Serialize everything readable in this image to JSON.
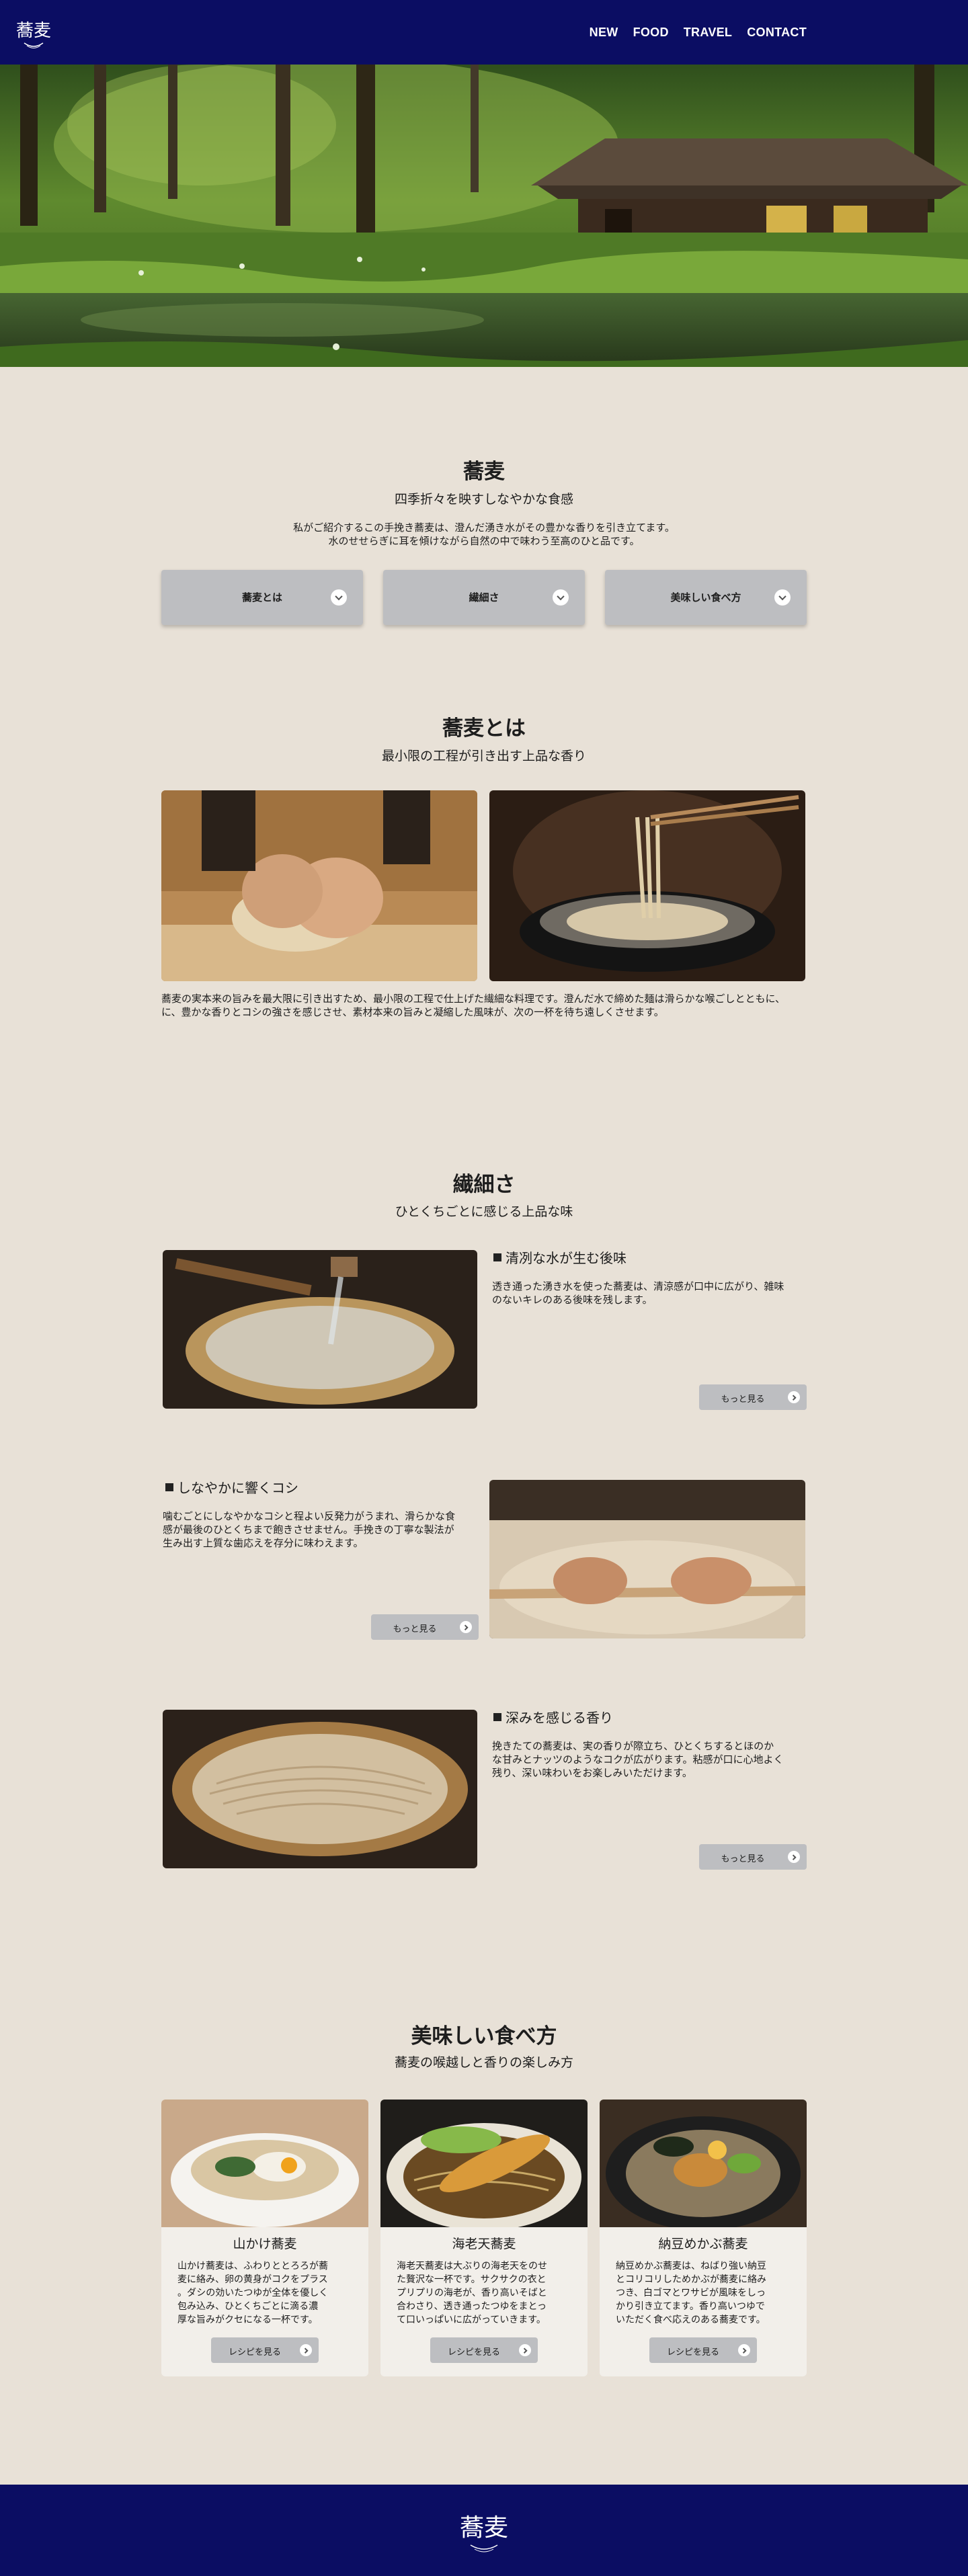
{
  "header": {
    "logo_text": "蕎麦",
    "nav": [
      "NEW",
      "FOOD",
      "TRAVEL",
      "CONTACT"
    ]
  },
  "soba": {
    "title": "蕎麦",
    "subtitle": "四季折々を映すしなやかな食感",
    "intro_line1": "私がご紹介するこの手挽き蕎麦は、澄んだ湧き水がその豊かな香りを引き立てます。",
    "intro_line2": "水のせせらぎに耳を傾けながら自然の中で味わう至高のひと品です。",
    "accordion": [
      "蕎麦とは",
      "繊細さ",
      "美味しい食べ方"
    ]
  },
  "about": {
    "title": "蕎麦とは",
    "subtitle": "最小限の工程が引き出す上品な香り",
    "text_line1": "蕎麦の実本来の旨みを最大限に引き出すため、最小限の工程で仕上げた繊細な料理です。澄んだ水で締めた麺は滑らかな喉ごしとともに、",
    "text_line2": "に、豊かな香りとコシの強さを感じさせ、素材本来の旨みと凝縮した風味が、次の一杯を待ち遠しくさせます。"
  },
  "delicacy": {
    "title": "繊細さ",
    "subtitle": "ひとくちごとに感じる上品な味",
    "features": [
      {
        "title": "清冽な水が生む後味",
        "lines": [
          "透き通った湧き水を使った蕎麦は、清涼感が口中に広がり、雑味",
          "のないキレのある後味を残します。"
        ],
        "button": "もっと見る"
      },
      {
        "title": "しなやかに響くコシ",
        "lines": [
          "噛むごとにしなやかなコシと程よい反発力がうまれ、滑らかな食",
          "感が最後のひとくちまで飽きさせません。手挽きの丁寧な製法が",
          "生み出す上質な歯応えを存分に味わえます。"
        ],
        "button": "もっと見る"
      },
      {
        "title": "深みを感じる香り",
        "lines": [
          "挽きたての蕎麦は、実の香りが際立ち、ひとくちするとほのか",
          "な甘みとナッツのようなコクが広がります。粘感が口に心地よく",
          "残り、深い味わいをお楽しみいただけます。"
        ],
        "button": "もっと見る"
      }
    ]
  },
  "eating": {
    "title": "美味しい食べ方",
    "subtitle": "蕎麦の喉越しと香りの楽しみ方",
    "cards": [
      {
        "name": "山かけ蕎麦",
        "lines": [
          "山かけ蕎麦は、ふわりととろろが蕎",
          "麦に絡み、卵の黄身がコクをプラス",
          "。ダシの効いたつゆが全体を優しく",
          "包み込み、ひとくちごとに滴る濃",
          "厚な旨みがクセになる一杯です。"
        ],
        "button": "レシピを見る"
      },
      {
        "name": "海老天蕎麦",
        "lines": [
          "海老天蕎麦は大ぶりの海老天をのせ",
          "た贅沢な一杯です。サクサクの衣と",
          "プリプリの海老が、香り高いそばと",
          "合わさり、透き通ったつゆをまとっ",
          "て口いっぱいに広がっていきます。"
        ],
        "button": "レシピを見る"
      },
      {
        "name": "納豆めかぶ蕎麦",
        "lines": [
          "納豆めかぶ蕎麦は、ねばり強い納豆",
          "とコリコリしためかぶが蕎麦に絡み",
          "つき、白ゴマとワサビが風味をしっ",
          "かり引き立てます。香り高いつゆで",
          "いただく食べ応えのある蕎麦です。"
        ],
        "button": "レシピを見る"
      }
    ]
  },
  "footer": {
    "logo_text": "蕎麦"
  },
  "colors": {
    "navy": "#0b0d63",
    "background": "#e8e1d7",
    "button": "#bdbec1",
    "card": "#f2efea"
  },
  "icons": [
    "chevron-down-icon",
    "chevron-right-icon",
    "square-bullet-icon"
  ]
}
